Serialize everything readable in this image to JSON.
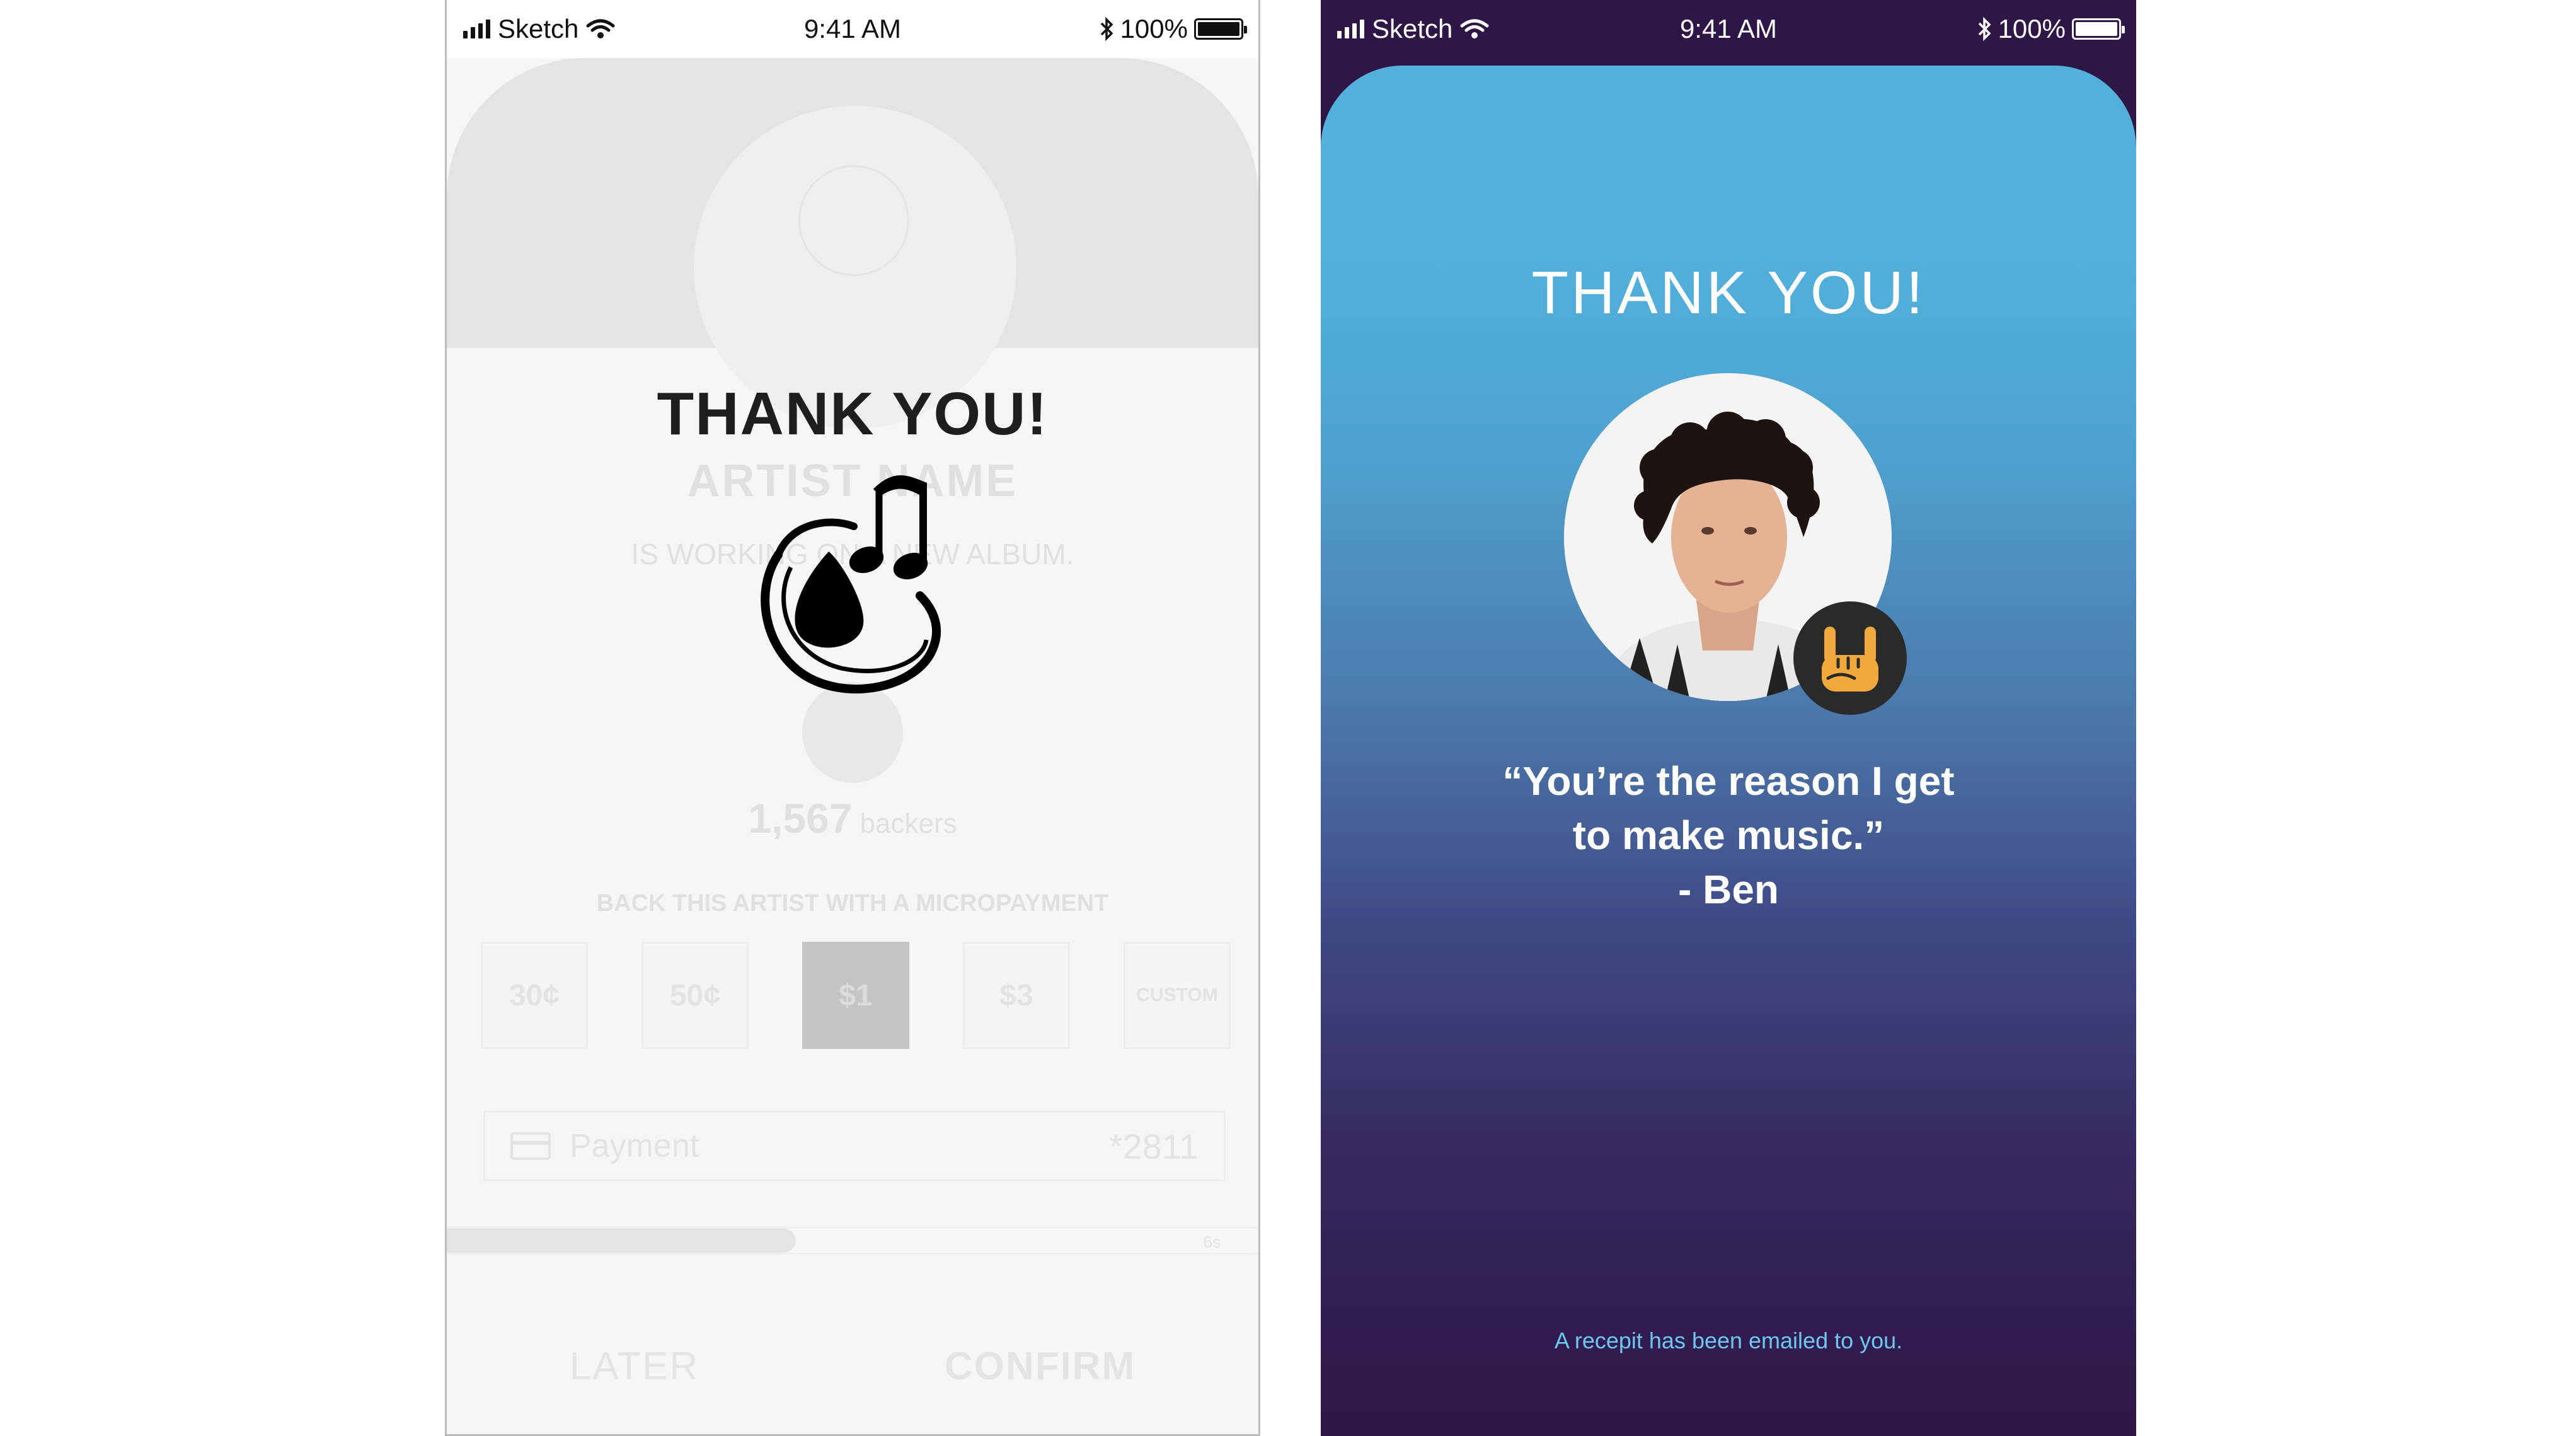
{
  "status_bar": {
    "carrier": "Sketch",
    "time": "9:41 AM",
    "battery": "100%"
  },
  "left_screen": {
    "background": {
      "artist_name": "ARTIST NAME",
      "subtitle": "IS WORKING ON A NEW ALBUM.",
      "backers_count": "1,567",
      "backers_label": "backers",
      "back_title": "BACK THIS ARTIST WITH A MICROPAYMENT",
      "amounts": [
        "30¢",
        "50¢",
        "$1",
        "$3",
        "CUSTOM"
      ],
      "selected_amount": "$1",
      "payment_label": "Payment",
      "payment_last4": "*2811",
      "progress_fraction": 0.43,
      "progress_time": "6s",
      "later_label": "LATER",
      "confirm_label": "CONFIRM"
    },
    "overlay_title": "THANK YOU!",
    "logo_icon": "music-planet-icon"
  },
  "right_screen": {
    "title": "THANK YOU!",
    "quote_line1": "“You’re the reason I get",
    "quote_line2": "to make music.”",
    "quote_author": "- Ben",
    "badge_icon": "rock-hand-icon",
    "receipt_text": "A recepit has been emailed to you.",
    "colors": {
      "gradient_top": "#53b0db",
      "gradient_bottom": "#2e1646",
      "badge_fill": "#f2a93b",
      "receipt_text": "#6fc6ee"
    }
  }
}
